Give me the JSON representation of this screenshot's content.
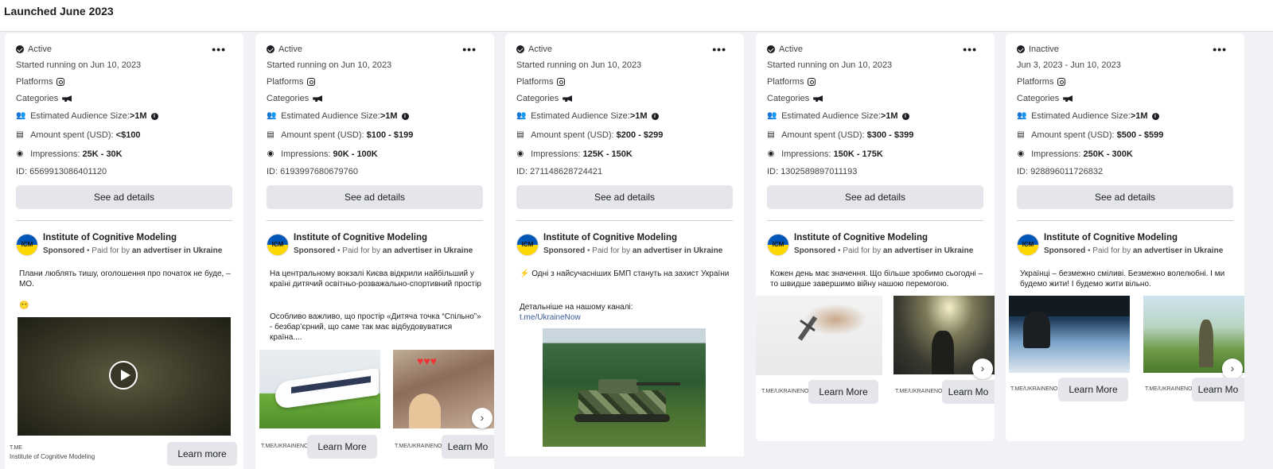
{
  "page": {
    "heading": "Launched June 2023"
  },
  "labels": {
    "started_prefix": "Started running on ",
    "platforms": "Platforms",
    "categories": "Categories",
    "audience": "Estimated Audience Size:",
    "amount": "Amount spent (USD): ",
    "impressions": "Impressions: ",
    "id_prefix": "ID: ",
    "see_details": "See ad details",
    "advertiser": "Institute of Cognitive Modeling",
    "avatar_text": "ICM",
    "sponsored": "Sponsored",
    "paid_for_by": " • Paid for by ",
    "paid_for_name": "an advertiser in Ukraine",
    "menu": "•••"
  },
  "cards": [
    {
      "status": "Active",
      "dates": "Started running on Jun 10, 2023",
      "audience": ">1M",
      "amount": "<$100",
      "impressions": "25K - 30K",
      "id": "ID: 6569913086401120",
      "text1": "Плани люблять тишу, оголошення про початок не буде, – МО.",
      "text2": "😶",
      "caption1": "T.ME",
      "caption2": "Institute of Cognitive Modeling",
      "learn": "Learn more"
    },
    {
      "status": "Active",
      "dates": "Started running on Jun 10, 2023",
      "audience": ">1M",
      "amount": "$100 - $199",
      "impressions": "90K - 100K",
      "id": "ID: 6193997680679760",
      "text1": "На центральному вокзалі Києва відкрили найбільший у країні дитячий освітньо-розважально-спортивний простір",
      "text2": "Особливо важливо, що простір «Дитяча точка “Спільно”» - безбар’єрний, що саме так має відбудовуватися країна....",
      "caption1": "T.ME/UKRAINENO",
      "caption2": "T.ME/UKRAINENO",
      "learn": "Learn More",
      "learn2": "Learn Mo",
      "arrow": "›"
    },
    {
      "status": "Active",
      "dates": "Started running on Jun 10, 2023",
      "audience": ">1M",
      "amount": "$200 - $299",
      "impressions": "125K - 150K",
      "id": "ID: 271148628724421",
      "text1": "⚡ Одні з найсучасніших БМП стануть на захист України",
      "text2": "Детальніше на нашому каналі:",
      "link": "t.me/UkraineNow"
    },
    {
      "status": "Active",
      "dates": "Started running on Jun 10, 2023",
      "audience": ">1M",
      "amount": "$300 - $399",
      "impressions": "150K - 175K",
      "id": "ID: 1302589897011193",
      "text1": "Кожен день має значення. Що більше зробимо сьогодні – то швидше завершимо війну нашою перемогою.",
      "caption1": "T.ME/UKRAINENO",
      "caption2": "T.ME/UKRAINENO",
      "learn": "Learn More",
      "learn2": "Learn Mo",
      "arrow": "›"
    },
    {
      "status": "Inactive",
      "dates": "Jun 3, 2023 - Jun 10, 2023",
      "audience": ">1M",
      "amount": "$500 - $599",
      "impressions": "250K - 300K",
      "id": "ID: 928896011726832",
      "text1": "Українці – безмежно сміливі. Безмежно волелюбні. І ми будемо жити! І будемо жити вільно.",
      "caption1": "T.ME/UKRAINENO",
      "caption2": "T.ME/UKRAINENO",
      "learn": "Learn More",
      "learn2": "Learn Mo",
      "arrow": "›"
    }
  ]
}
